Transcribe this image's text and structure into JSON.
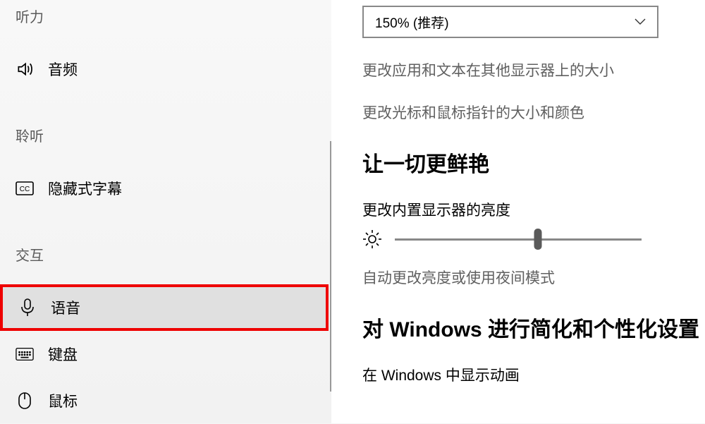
{
  "sidebar": {
    "headers": {
      "hearing": "听力",
      "closed_captions": "聆听",
      "interaction": "交互"
    },
    "items": {
      "audio": "音频",
      "captions": "隐藏式字幕",
      "speech": "语音",
      "keyboard": "键盘",
      "mouse": "鼠标"
    }
  },
  "main": {
    "scale_dropdown": "150% (推荐)",
    "link_other_displays": "更改应用和文本在其他显示器上的大小",
    "link_cursor": "更改光标和鼠标指针的大小和颜色",
    "section_vivid": "让一切更鲜艳",
    "brightness_label": "更改内置显示器的亮度",
    "auto_brightness": "自动更改亮度或使用夜间模式",
    "section_personalize": "对 Windows 进行简化和个性化设置",
    "show_animations_label": "在 Windows 中显示动画"
  }
}
